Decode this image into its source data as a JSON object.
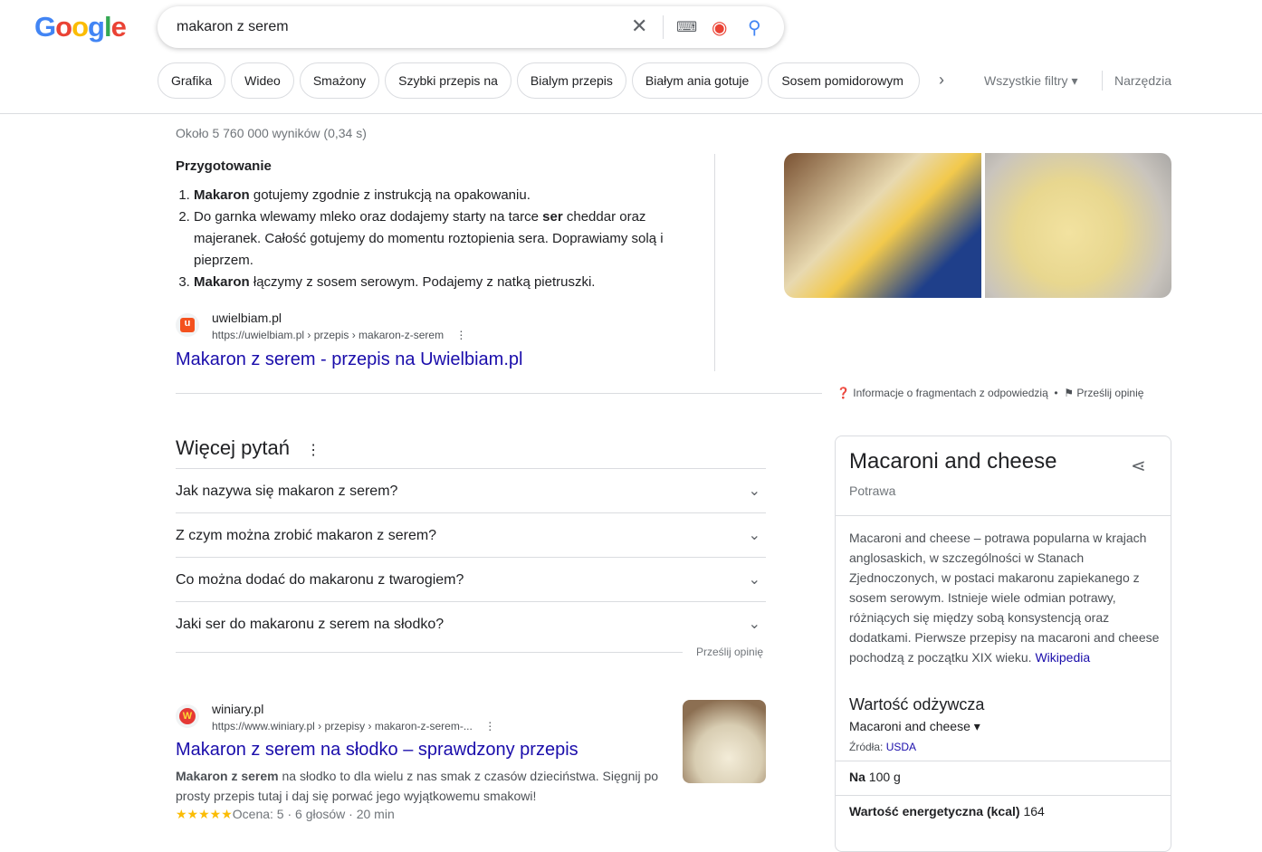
{
  "logo": "Google",
  "search": {
    "query": "makaron z serem"
  },
  "chips": [
    "Grafika",
    "Wideo",
    "Smażony",
    "Szybki przepis na",
    "Bialym przepis",
    "Białym ania gotuje",
    "Sosem pomidorowym"
  ],
  "filters": {
    "all": "Wszystkie filtry",
    "tools": "Narzędzia"
  },
  "stats": "Około 5 760 000 wyników (0,34 s)",
  "snippet": {
    "heading": "Przygotowanie",
    "steps": [
      {
        "bold": "Makaron",
        "text": " gotujemy zgodnie z instrukcją na opakowaniu."
      },
      {
        "pre": "Do garnka wlewamy mleko oraz dodajemy starty na tarce ",
        "bold": "ser",
        "text": " cheddar oraz majeranek. Całość gotujemy do momentu roztopienia sera. Doprawiamy solą i pieprzem."
      },
      {
        "bold": "Makaron",
        "text": " łączymy z sosem serowym. Podajemy z natką pietruszki."
      }
    ],
    "site": "uwielbiam.pl",
    "url": "https://uwielbiam.pl › przepis › makaron-z-serem",
    "title": "Makaron z serem - przepis na Uwielbiam.pl",
    "about": "Informacje o fragmentach z odpowiedzią",
    "feedback": "Prześlij opinię"
  },
  "paa": {
    "title": "Więcej pytań",
    "questions": [
      "Jak nazywa się makaron z serem?",
      "Z czym można zrobić makaron z serem?",
      "Co można dodać do makaronu z twarogiem?",
      "Jaki ser do makaronu z serem na słodko?"
    ],
    "feedback": "Prześlij opinię"
  },
  "result": {
    "site": "winiary.pl",
    "url": "https://www.winiary.pl › przepisy › makaron-z-serem-...",
    "title": "Makaron z serem na słodko – sprawdzony przepis",
    "bold": "Makaron z serem",
    "desc": " na słodko to dla wielu z nas smak z czasów dzieciństwa. Sięgnij po prosty przepis tutaj i daj się porwać jego wyjątkowemu smakowi!",
    "stars": "★★★★★",
    "rating": "Ocena: 5 · 6 głosów · 20 min"
  },
  "kp": {
    "title": "Macaroni and cheese",
    "subtitle": "Potrawa",
    "desc": "Macaroni and cheese – potrawa popularna w krajach anglosaskich, w szczególności w Stanach Zjednoczonych, w postaci makaronu zapiekanego z sosem serowym. Istnieje wiele odmian potrawy, różniących się między sobą konsystencją oraz dodatkami. Pierwsze przepisy na macaroni and cheese pochodzą z początku XIX wieku. ",
    "wiki": "Wikipedia",
    "nutrition": "Wartość odżywcza",
    "select": "Macaroni and cheese",
    "source_label": "Źródła: ",
    "source": "USDA",
    "per_label": "Na",
    "per": " 100 g",
    "energy_label": "Wartość energetyczna (kcal)",
    "energy": " 164"
  }
}
